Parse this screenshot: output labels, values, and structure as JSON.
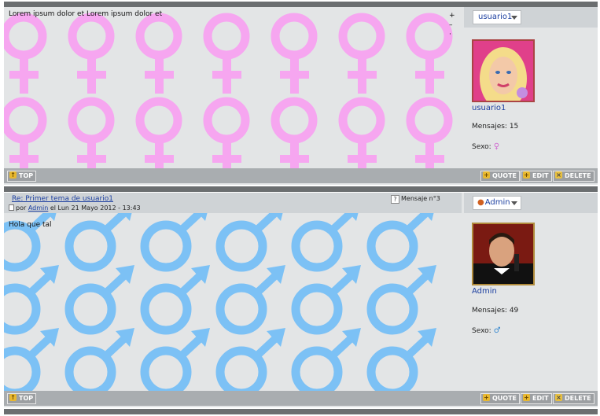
{
  "post1": {
    "text": "Lorem ipsum dolor et Lorem ipsum dolor et",
    "zoom_plus": "+",
    "zoom_minus": "–",
    "zoom_dot": "·",
    "user_button": "usuario1",
    "username": "usuario1",
    "messages_label": "Mensajes: 15",
    "sex_label": "Sexo:",
    "sex_icon": "female-symbol-icon",
    "pattern_color": "#f6a6f0",
    "footer": {
      "top": "TOP",
      "quote": "QUOTE",
      "edit": "EDIT",
      "delete": "DELETE"
    }
  },
  "post2": {
    "title": "Re: Primer tema de usuario1",
    "meta_prefix": "por",
    "meta_author": "Admin",
    "meta_date": "el Lun 21 Mayo 2012 - 13:43",
    "message_number": "Mensaje n°3",
    "text": "Hola que tal",
    "user_button": "Admin",
    "username": "Admin",
    "messages_label": "Mensajes: 49",
    "sex_label": "Sexo:",
    "sex_icon": "male-symbol-icon",
    "pattern_color": "#7cc1f5",
    "footer": {
      "top": "TOP",
      "quote": "QUOTE",
      "edit": "EDIT",
      "delete": "DELETE"
    }
  },
  "colors": {
    "panel": "#e3e5e6",
    "header": "#cfd3d6",
    "footer": "#a9adb0",
    "link": "#1c3fa0",
    "bar": "#6b6e70"
  }
}
